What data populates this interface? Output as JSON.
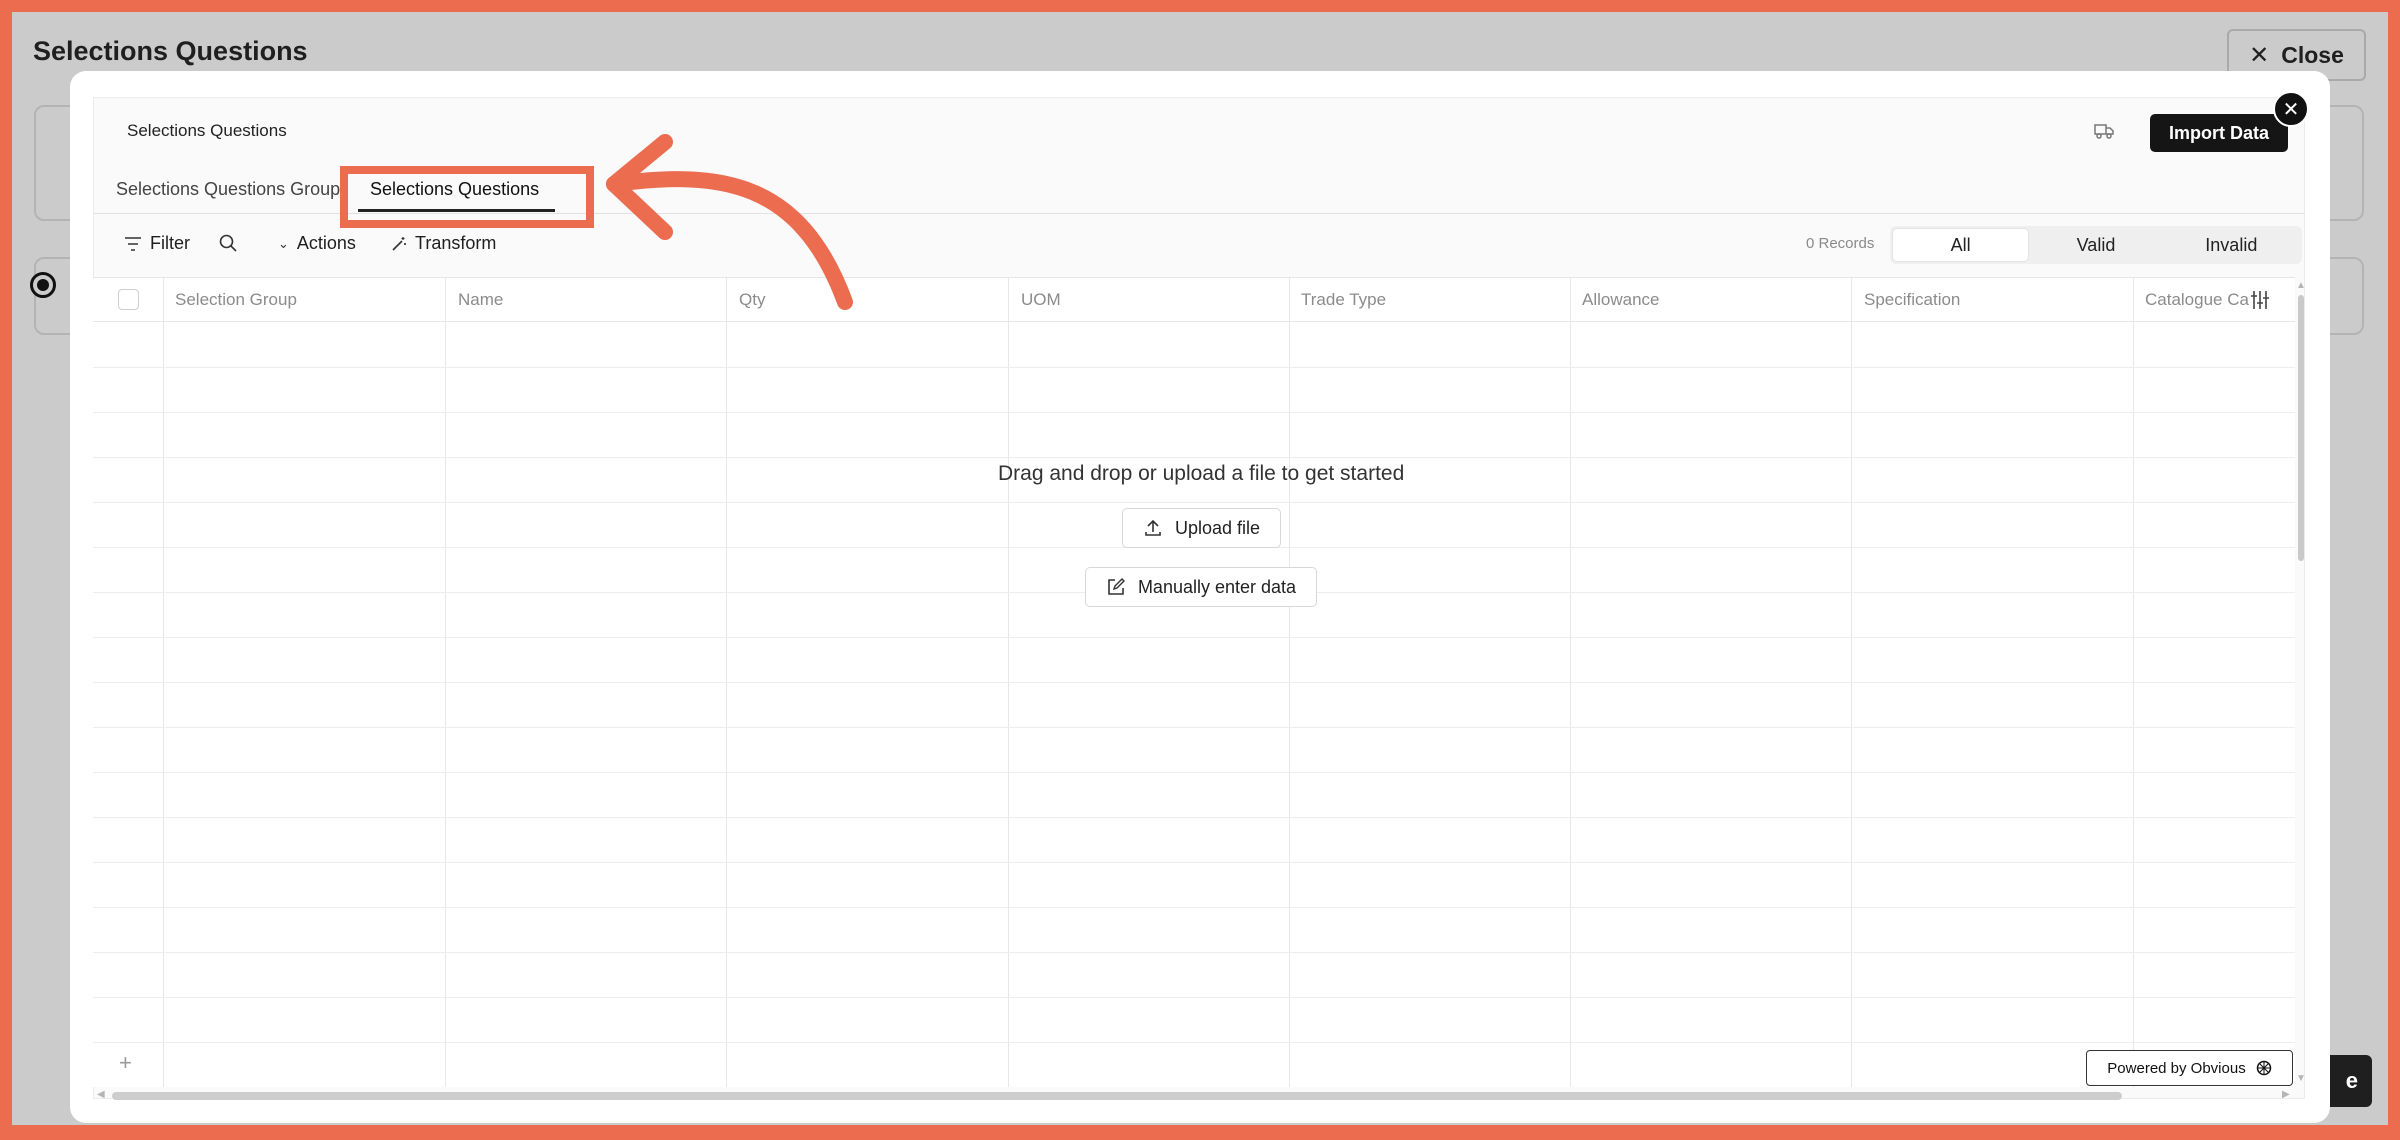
{
  "background": {
    "title": "Selections Questions",
    "close_label": "Close",
    "dark_button_label": "e"
  },
  "importer": {
    "title": "Selections Questions",
    "import_button": "Import Data",
    "tabs": [
      {
        "label": "Selections Questions Group"
      },
      {
        "label": "Selections Questions"
      }
    ],
    "toolbar": {
      "filter": "Filter",
      "actions": "Actions",
      "transform": "Transform",
      "records": "0 Records",
      "segments": [
        "All",
        "Valid",
        "Invalid"
      ],
      "active_segment": "All"
    },
    "columns": [
      "Selection Group",
      "Name",
      "Qty",
      "UOM",
      "Trade Type",
      "Allowance",
      "Specification",
      "Catalogue Ca"
    ],
    "empty_state": {
      "message": "Drag and drop or upload a file to get started",
      "upload": "Upload file",
      "manual": "Manually enter data"
    },
    "add_row": "+",
    "powered_by": "Powered by Obvious"
  },
  "colors": {
    "annotation": "#ec6c4f",
    "primary_button": "#151515"
  }
}
